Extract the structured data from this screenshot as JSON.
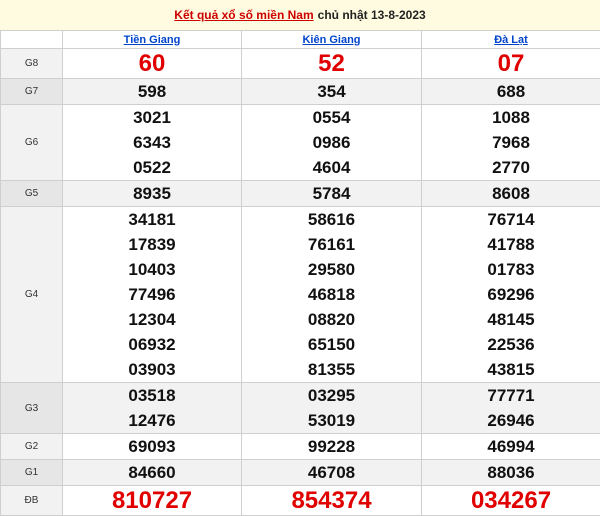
{
  "header": {
    "link": "Kết quả xổ số miền Nam",
    "date": "chủ nhật 13-8-2023"
  },
  "provinces": [
    "Tiền Giang",
    "Kiên Giang",
    "Đà Lạt"
  ],
  "rows": [
    {
      "label": "G8",
      "style": "big",
      "alt": false,
      "values": [
        [
          "60"
        ],
        [
          "52"
        ],
        [
          "07"
        ]
      ]
    },
    {
      "label": "G7",
      "style": "normal",
      "alt": true,
      "values": [
        [
          "598"
        ],
        [
          "354"
        ],
        [
          "688"
        ]
      ]
    },
    {
      "label": "G6",
      "style": "normal",
      "alt": false,
      "values": [
        [
          "3021",
          "6343",
          "0522"
        ],
        [
          "0554",
          "0986",
          "4604"
        ],
        [
          "1088",
          "7968",
          "2770"
        ]
      ]
    },
    {
      "label": "G5",
      "style": "normal",
      "alt": true,
      "values": [
        [
          "8935"
        ],
        [
          "5784"
        ],
        [
          "8608"
        ]
      ]
    },
    {
      "label": "G4",
      "style": "normal",
      "alt": false,
      "values": [
        [
          "34181",
          "17839",
          "10403",
          "77496",
          "12304",
          "06932",
          "03903"
        ],
        [
          "58616",
          "76161",
          "29580",
          "46818",
          "08820",
          "65150",
          "81355"
        ],
        [
          "76714",
          "41788",
          "01783",
          "69296",
          "48145",
          "22536",
          "43815"
        ]
      ]
    },
    {
      "label": "G3",
      "style": "normal",
      "alt": true,
      "values": [
        [
          "03518",
          "12476"
        ],
        [
          "03295",
          "53019"
        ],
        [
          "77771",
          "26946"
        ]
      ]
    },
    {
      "label": "G2",
      "style": "normal",
      "alt": false,
      "values": [
        [
          "69093"
        ],
        [
          "99228"
        ],
        [
          "46994"
        ]
      ]
    },
    {
      "label": "G1",
      "style": "normal",
      "alt": true,
      "values": [
        [
          "84660"
        ],
        [
          "46708"
        ],
        [
          "88036"
        ]
      ]
    },
    {
      "label": "ĐB",
      "style": "db",
      "alt": false,
      "values": [
        [
          "810727"
        ],
        [
          "854374"
        ],
        [
          "034267"
        ]
      ]
    }
  ]
}
